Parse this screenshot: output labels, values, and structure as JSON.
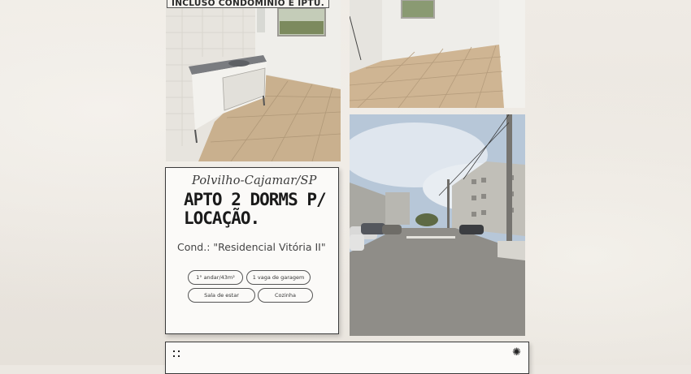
{
  "banner": {
    "text": "INCLUSO CONDOMÍNIO E IPTU."
  },
  "info": {
    "location": "Polvilho-Cajamar/SP",
    "headline_line1": "APTO 2 DORMS P/",
    "headline_line2": "LOCAÇÃO.",
    "condo": "Cond.: \"Residencial Vitória II\""
  },
  "features": {
    "floor": "1° andar/43m²",
    "parking": "1 vaga de garagem",
    "living": "Sala de estar",
    "kitchen": "Cozinha"
  },
  "photos": {
    "kitchen": "kitchen photo",
    "bedroom": "bedroom photo",
    "street": "street photo"
  }
}
